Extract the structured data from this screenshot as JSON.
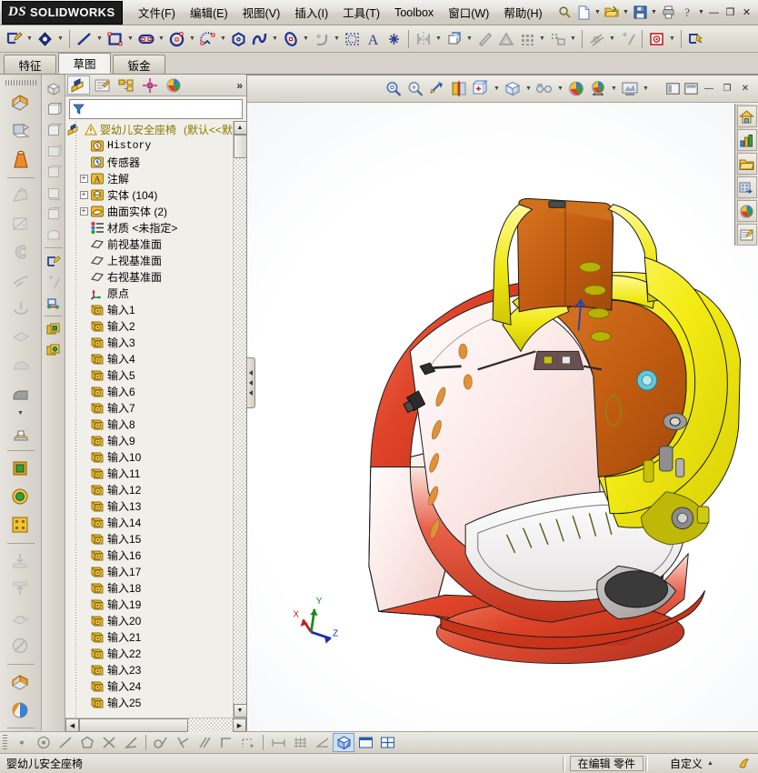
{
  "app": {
    "brand": "SOLIDWORKS",
    "brand_mark": "DS"
  },
  "menu": {
    "items": [
      {
        "label": "文件(F)"
      },
      {
        "label": "编辑(E)"
      },
      {
        "label": "视图(V)"
      },
      {
        "label": "插入(I)"
      },
      {
        "label": "工具(T)"
      },
      {
        "label": "Toolbox"
      },
      {
        "label": "窗口(W)"
      },
      {
        "label": "帮助(H)"
      }
    ],
    "quick_access": [
      {
        "name": "search-icon"
      },
      {
        "name": "new-document-icon"
      },
      {
        "name": "open-document-icon"
      },
      {
        "name": "save-icon"
      },
      {
        "name": "print-icon"
      },
      {
        "name": "help-icon"
      }
    ],
    "window_controls": [
      {
        "name": "minimize-icon",
        "glyph": "—"
      },
      {
        "name": "restore-icon",
        "glyph": "❐"
      },
      {
        "name": "close-icon",
        "glyph": "✕"
      }
    ]
  },
  "sketch_toolbar": {
    "tools": [
      {
        "name": "sketch-icon"
      },
      {
        "name": "smart-dimension-icon"
      },
      {
        "name": "line-icon"
      },
      {
        "name": "rectangle-icon"
      },
      {
        "name": "slot-icon"
      },
      {
        "name": "circle-icon"
      },
      {
        "name": "arc-icon"
      },
      {
        "name": "polygon-icon"
      },
      {
        "name": "spline-icon"
      },
      {
        "name": "ellipse-icon"
      },
      {
        "name": "fillet-icon"
      },
      {
        "name": "trim-icon"
      },
      {
        "name": "text-icon"
      },
      {
        "name": "point-icon"
      },
      {
        "name": "mirror-icon"
      },
      {
        "name": "linear-pattern-icon"
      },
      {
        "name": "offset-entities-icon"
      },
      {
        "name": "convert-entities-icon"
      },
      {
        "name": "grid-icon"
      },
      {
        "name": "jog-line-icon"
      },
      {
        "name": "add-relation-icon"
      },
      {
        "name": "repair-sketch-icon"
      },
      {
        "name": "quick-snaps-icon"
      },
      {
        "name": "rapid-sketch-icon"
      }
    ]
  },
  "command_tabs": {
    "tabs": [
      {
        "label": "特征",
        "active": false
      },
      {
        "label": "草图",
        "active": true
      },
      {
        "label": "钣金",
        "active": false
      }
    ]
  },
  "left_toolbar": {
    "groups": [
      [
        "extruded-boss-icon",
        "revolved-boss-icon",
        "swept-boss-icon"
      ],
      [
        "lofted-boss-icon",
        "boundary-boss-icon",
        "extruded-cut-icon",
        "hole-wizard-icon",
        "revolved-cut-icon",
        "swept-cut-icon",
        "lofted-cut-icon",
        "fillet-icon"
      ],
      [
        "rib-icon",
        "draft-icon",
        "shell-icon"
      ],
      [
        "linear-pattern-icon",
        "mirror-icon",
        "reference-geometry-icon",
        "curves-icon"
      ],
      [
        "instant3d-icon",
        "appearance-icon"
      ]
    ]
  },
  "feature_manager_strip": {
    "icons": [
      "isometric-view-icon",
      "front-view-icon",
      "back-view-icon",
      "left-view-icon",
      "right-view-icon",
      "top-view-icon",
      "bottom-view-icon",
      "normal-to-icon",
      "edit-sketch-icon",
      "dimension-icon",
      "relation-icon",
      "configuration-icon",
      "display-state-icon"
    ]
  },
  "tree_panel": {
    "tabs": [
      {
        "name": "feature-manager-tab",
        "selected": true
      },
      {
        "name": "property-manager-tab",
        "selected": false
      },
      {
        "name": "configuration-manager-tab",
        "selected": false
      },
      {
        "name": "dimxpert-manager-tab",
        "selected": false
      },
      {
        "name": "display-manager-tab",
        "selected": false
      }
    ],
    "more_glyph": "»",
    "filter_placeholder": "",
    "root": {
      "label": "婴幼儿安全座椅",
      "suffix": "(默认<<默",
      "has_warning": true
    },
    "items": [
      {
        "label": "History",
        "icon": "history-icon",
        "indent": 1,
        "expandable": false,
        "mono": true
      },
      {
        "label": "传感器",
        "icon": "sensors-icon",
        "indent": 1,
        "expandable": false
      },
      {
        "label": "注解",
        "icon": "annotations-icon",
        "indent": 1,
        "expandable": true
      },
      {
        "label": "实体 (104)",
        "icon": "solid-bodies-icon",
        "indent": 1,
        "expandable": true
      },
      {
        "label": "曲面实体 (2)",
        "icon": "surface-bodies-icon",
        "indent": 1,
        "expandable": true
      },
      {
        "label": "材质 <未指定>",
        "icon": "material-icon",
        "indent": 1,
        "expandable": false
      },
      {
        "label": "前视基准面",
        "icon": "plane-icon",
        "indent": 1,
        "expandable": false
      },
      {
        "label": "上视基准面",
        "icon": "plane-icon",
        "indent": 1,
        "expandable": false
      },
      {
        "label": "右视基准面",
        "icon": "plane-icon",
        "indent": 1,
        "expandable": false
      },
      {
        "label": "原点",
        "icon": "origin-icon",
        "indent": 1,
        "expandable": false
      },
      {
        "label": "输入1",
        "icon": "imported-feature-icon",
        "indent": 1,
        "expandable": false
      },
      {
        "label": "输入2",
        "icon": "imported-feature-icon",
        "indent": 1,
        "expandable": false
      },
      {
        "label": "输入3",
        "icon": "imported-feature-icon",
        "indent": 1,
        "expandable": false
      },
      {
        "label": "输入4",
        "icon": "imported-feature-icon",
        "indent": 1,
        "expandable": false
      },
      {
        "label": "输入5",
        "icon": "imported-feature-icon",
        "indent": 1,
        "expandable": false
      },
      {
        "label": "输入6",
        "icon": "imported-feature-icon",
        "indent": 1,
        "expandable": false
      },
      {
        "label": "输入7",
        "icon": "imported-feature-icon",
        "indent": 1,
        "expandable": false
      },
      {
        "label": "输入8",
        "icon": "imported-feature-icon",
        "indent": 1,
        "expandable": false
      },
      {
        "label": "输入9",
        "icon": "imported-feature-icon",
        "indent": 1,
        "expandable": false
      },
      {
        "label": "输入10",
        "icon": "imported-feature-icon",
        "indent": 1,
        "expandable": false
      },
      {
        "label": "输入11",
        "icon": "imported-feature-icon",
        "indent": 1,
        "expandable": false
      },
      {
        "label": "输入12",
        "icon": "imported-feature-icon",
        "indent": 1,
        "expandable": false
      },
      {
        "label": "输入13",
        "icon": "imported-feature-icon",
        "indent": 1,
        "expandable": false
      },
      {
        "label": "输入14",
        "icon": "imported-feature-icon",
        "indent": 1,
        "expandable": false
      },
      {
        "label": "输入15",
        "icon": "imported-feature-icon",
        "indent": 1,
        "expandable": false
      },
      {
        "label": "输入16",
        "icon": "imported-feature-icon",
        "indent": 1,
        "expandable": false
      },
      {
        "label": "输入17",
        "icon": "imported-feature-icon",
        "indent": 1,
        "expandable": false
      },
      {
        "label": "输入18",
        "icon": "imported-feature-icon",
        "indent": 1,
        "expandable": false
      },
      {
        "label": "输入19",
        "icon": "imported-feature-icon",
        "indent": 1,
        "expandable": false
      },
      {
        "label": "输入20",
        "icon": "imported-feature-icon",
        "indent": 1,
        "expandable": false
      },
      {
        "label": "输入21",
        "icon": "imported-feature-icon",
        "indent": 1,
        "expandable": false
      },
      {
        "label": "输入22",
        "icon": "imported-feature-icon",
        "indent": 1,
        "expandable": false
      },
      {
        "label": "输入23",
        "icon": "imported-feature-icon",
        "indent": 1,
        "expandable": false
      },
      {
        "label": "输入24",
        "icon": "imported-feature-icon",
        "indent": 1,
        "expandable": false
      },
      {
        "label": "输入25",
        "icon": "imported-feature-icon",
        "indent": 1,
        "expandable": false
      }
    ]
  },
  "view_toolbar": {
    "buttons": [
      {
        "name": "zoom-to-fit-icon"
      },
      {
        "name": "zoom-to-area-icon"
      },
      {
        "name": "previous-view-icon"
      },
      {
        "name": "section-view-icon"
      },
      {
        "name": "view-orientation-icon"
      },
      {
        "name": "display-style-icon"
      },
      {
        "name": "hide-show-items-icon"
      },
      {
        "name": "edit-appearance-icon"
      },
      {
        "name": "apply-scene-icon"
      },
      {
        "name": "view-settings-icon"
      }
    ],
    "window_buttons": [
      {
        "name": "tile-horizontally-icon"
      },
      {
        "name": "tile-vertically-icon"
      },
      {
        "name": "minimize-window-icon",
        "glyph": "—"
      },
      {
        "name": "restore-window-icon",
        "glyph": "❐"
      },
      {
        "name": "close-window-icon",
        "glyph": "✕"
      }
    ]
  },
  "task_pane": {
    "items": [
      {
        "name": "solidworks-resources-icon"
      },
      {
        "name": "design-library-icon"
      },
      {
        "name": "file-explorer-icon"
      },
      {
        "name": "view-palette-icon"
      },
      {
        "name": "appearances-scenes-icon"
      },
      {
        "name": "custom-properties-icon"
      }
    ]
  },
  "graphics": {
    "triad": {
      "x_label": "X",
      "y_label": "Y",
      "z_label": "Z"
    },
    "model_name": "婴幼儿安全座椅",
    "colors": {
      "yellow": "#f2ea1c",
      "orange": "#c1590f",
      "red": "#e0452a",
      "pink": "#f6d7d4",
      "white": "#ffffff",
      "dark_gray": "#4a4a4a"
    }
  },
  "sketch_status_bar": {
    "relations": [
      {
        "name": "point-relation-icon"
      },
      {
        "name": "concentric-relation-icon"
      },
      {
        "name": "line-relation-icon"
      },
      {
        "name": "polygon-relation-icon"
      },
      {
        "name": "intersection-relation-icon"
      },
      {
        "name": "angle-relation-icon"
      },
      {
        "name": "tangent-relation-icon"
      },
      {
        "name": "perpendicular-relation-icon"
      },
      {
        "name": "parallel-relation-icon"
      },
      {
        "name": "corner-relation-icon"
      },
      {
        "name": "midpoint-relation-icon"
      },
      {
        "name": "length-dimension-icon"
      },
      {
        "name": "grid-snap-icon"
      },
      {
        "name": "angle-dimension-icon"
      }
    ],
    "display_buttons": [
      {
        "name": "shaded-with-edges-icon",
        "pressed": true
      },
      {
        "name": "single-view-icon",
        "pressed": false
      },
      {
        "name": "two-view-horizontal-icon",
        "pressed": false
      }
    ]
  },
  "status_bar": {
    "document_name": "婴幼儿安全座椅",
    "edit_state": "在编辑  零件",
    "units": "自定义",
    "units_caret": "▲"
  }
}
